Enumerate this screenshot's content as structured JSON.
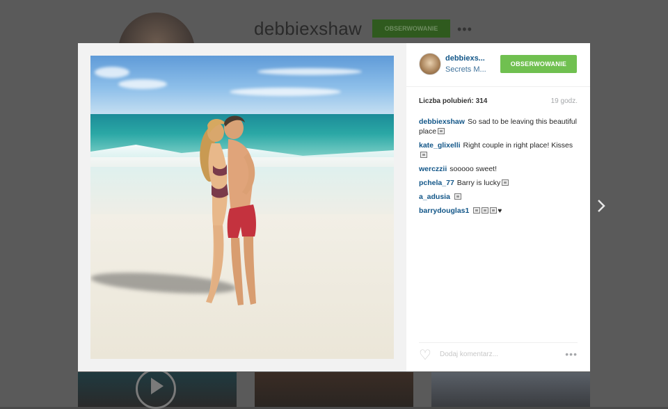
{
  "background_profile": {
    "username": "debbiexshaw",
    "follow_label": "OBSERWOWANIE",
    "more": "•••"
  },
  "post": {
    "username": "debbiexs...",
    "location": "Secrets M...",
    "follow_label": "OBSERWOWANIE",
    "likes_text": "Liczba polubień: 314",
    "time_text": "19 godz.",
    "comments": [
      {
        "user": "debbiexshaw",
        "text": "So sad to be leaving this beautiful place",
        "glyphs": 1,
        "heart": false
      },
      {
        "user": "kate_glixelli",
        "text": "Right couple in right place! Kisses",
        "glyphs": 1,
        "heart": false
      },
      {
        "user": "werczzii",
        "text": "sooooo sweet!",
        "glyphs": 0,
        "heart": false
      },
      {
        "user": "pchela_77",
        "text": "Barry is lucky",
        "glyphs": 1,
        "heart": false
      },
      {
        "user": "a_adusia",
        "text": "",
        "glyphs": 1,
        "heart": false
      },
      {
        "user": "barrydouglas1",
        "text": "",
        "glyphs": 3,
        "heart": true
      }
    ],
    "comment_placeholder": "Dodaj komentarz...",
    "more": "•••"
  },
  "icons": {
    "next": "chevron-right-icon",
    "heart": "heart-icon",
    "play": "play-icon"
  },
  "colors": {
    "follow_green": "#70c050",
    "username_blue": "#125688",
    "location_blue": "#3f729b"
  }
}
